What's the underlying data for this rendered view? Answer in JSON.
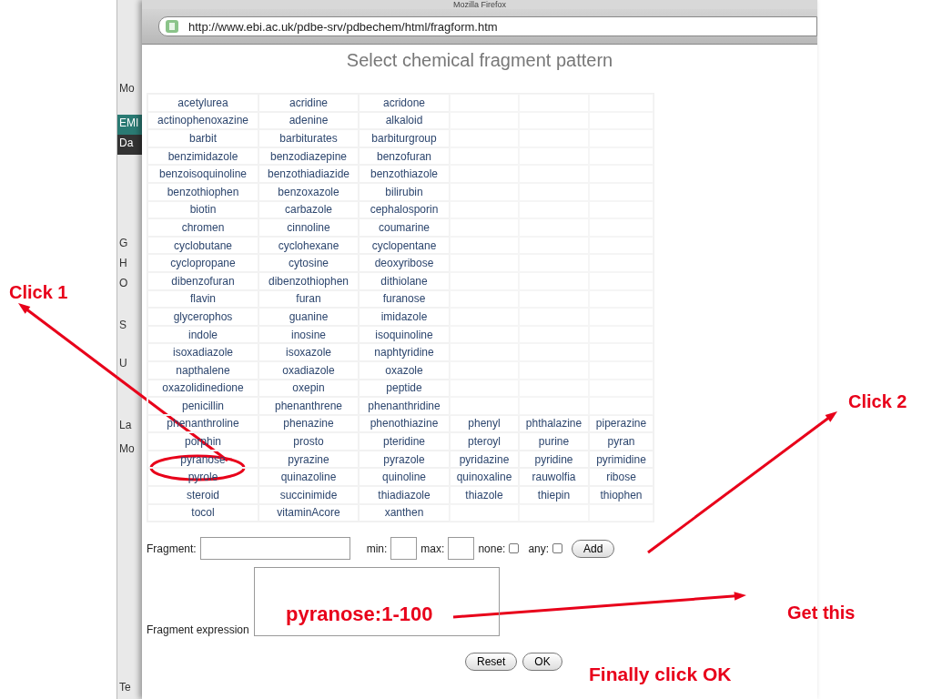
{
  "window": {
    "title": "Mozilla Firefox",
    "url": "http://www.ebi.ac.uk/pdbe-srv/pdbechem/html/fragform.htm"
  },
  "background_window": {
    "fragments": [
      "Mo",
      "EMI",
      "Da",
      "G",
      "H",
      "O",
      "S",
      "U",
      "La",
      "Mo",
      "Te"
    ]
  },
  "page": {
    "heading": "Select chemical fragment pattern"
  },
  "fragments": [
    [
      "acetylurea",
      "acridine",
      "acridone"
    ],
    [
      "actinophenoxazine",
      "adenine",
      "alkaloid"
    ],
    [
      "barbit",
      "barbiturates",
      "barbiturgroup"
    ],
    [
      "benzimidazole",
      "benzodiazepine",
      "benzofuran"
    ],
    [
      "benzoisoquinoline",
      "benzothiadiazide",
      "benzothiazole"
    ],
    [
      "benzothiophen",
      "benzoxazole",
      "bilirubin"
    ],
    [
      "biotin",
      "carbazole",
      "cephalosporin"
    ],
    [
      "chromen",
      "cinnoline",
      "coumarine"
    ],
    [
      "cyclobutane",
      "cyclohexane",
      "cyclopentane"
    ],
    [
      "cyclopropane",
      "cytosine",
      "deoxyribose"
    ],
    [
      "dibenzofuran",
      "dibenzothiophen",
      "dithiolane"
    ],
    [
      "flavin",
      "furan",
      "furanose"
    ],
    [
      "glycerophos",
      "guanine",
      "imidazole"
    ],
    [
      "indole",
      "inosine",
      "isoquinoline"
    ],
    [
      "isoxadiazole",
      "isoxazole",
      "naphtyridine"
    ],
    [
      "napthalene",
      "oxadiazole",
      "oxazole"
    ],
    [
      "oxazolidinedione",
      "oxepin",
      "peptide"
    ],
    [
      "penicillin",
      "phenanthrene",
      "phenanthridine"
    ],
    [
      "phenanthroline",
      "phenazine",
      "phenothiazine",
      "phenyl",
      "phthalazine",
      "piperazine"
    ],
    [
      "porphin",
      "prosto",
      "pteridine",
      "pteroyl",
      "purine",
      "pyran"
    ],
    [
      "pyranose",
      "pyrazine",
      "pyrazole",
      "pyridazine",
      "pyridine",
      "pyrimidine"
    ],
    [
      "pyrole",
      "quinazoline",
      "quinoline",
      "quinoxaline",
      "rauwolfia",
      "ribose"
    ],
    [
      "steroid",
      "succinimide",
      "thiadiazole",
      "thiazole",
      "thiepin",
      "thiophen"
    ],
    [
      "tocol",
      "vitaminAcore",
      "xanthen"
    ]
  ],
  "form": {
    "controls": [
      {
        "kind": "text",
        "label": "Fragment:"
      },
      {
        "kind": "short",
        "label": "min:"
      },
      {
        "kind": "short",
        "label": "max:"
      },
      {
        "kind": "checkbox",
        "label": "none:",
        "checked": false
      },
      {
        "kind": "checkbox",
        "label": "any:",
        "checked": false
      },
      {
        "kind": "button",
        "label": "Add"
      }
    ],
    "expression_label": "Fragment expression",
    "buttons": [
      "Reset",
      "OK"
    ]
  },
  "annotations": [
    "Click 1",
    "Click 2",
    "pyranose:1-100",
    "Get this",
    "Finally click OK"
  ]
}
